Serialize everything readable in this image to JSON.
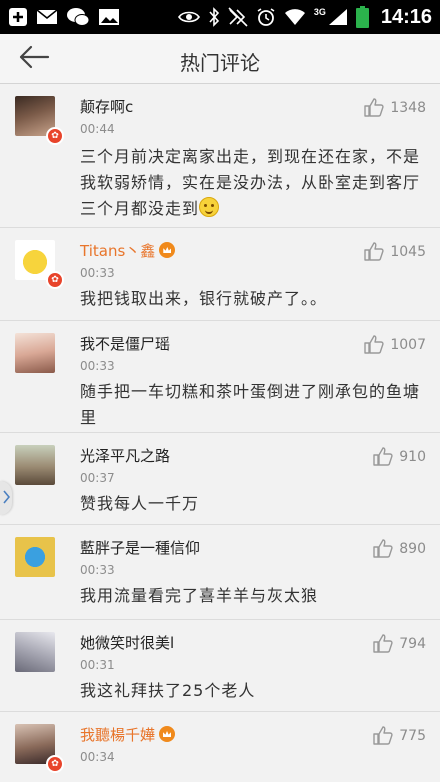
{
  "status_bar": {
    "time": "14:16",
    "network": "3G",
    "left_icons": [
      "add-icon",
      "mail-icon",
      "wechat-icon",
      "image-icon"
    ],
    "right_icons": [
      "eye-icon",
      "bluetooth-icon",
      "mute-icon",
      "alarm-icon",
      "wifi-icon",
      "signal-icon",
      "battery-icon"
    ]
  },
  "header": {
    "title": "热门评论",
    "back_icon": "back-arrow-icon"
  },
  "comments": [
    {
      "username": "颠存啊c",
      "time": "00:44",
      "likes": "1348",
      "text": "三个月前决定离家出走，到现在还在家，不是我软弱矫情，实在是没办法，从卧室走到客厅三个月都没走到",
      "avatar_color": "#6b4a3a",
      "emoji": true,
      "vip": false
    },
    {
      "username": "Titans丶鑫",
      "time": "00:33",
      "likes": "1045",
      "text": "我把钱取出来，银行就破产了。。",
      "avatar_color": "#f5d23b",
      "vip": true
    },
    {
      "username": "我不是僵尸瑶",
      "time": "00:33",
      "likes": "1007",
      "text": "随手把一车切糕和茶叶蛋倒进了刚承包的鱼塘里",
      "avatar_color": "#e6c3b5",
      "vip": false
    },
    {
      "username": "光泽平凡之路",
      "time": "00:37",
      "likes": "910",
      "text": "赞我每人一千万",
      "avatar_color": "#9aa68b",
      "vip": false
    },
    {
      "username": "藍胖子是一種信仰",
      "time": "00:33",
      "likes": "890",
      "text": "我用流量看完了喜羊羊与灰太狼",
      "avatar_color": "#d8b23c",
      "vip": false
    },
    {
      "username": "她微笑时很美l",
      "time": "00:31",
      "likes": "794",
      "text": "我这礼拜扶了25个老人",
      "avatar_color": "#b8b8c0",
      "vip": false
    },
    {
      "username": "我聽楊千嬅",
      "time": "00:34",
      "likes": "775",
      "text": "",
      "avatar_color": "#7a6a6a",
      "vip": true
    }
  ],
  "colors": {
    "accent": "#e8752b",
    "badge": "#e8442b",
    "background": "#f2f2f2"
  }
}
